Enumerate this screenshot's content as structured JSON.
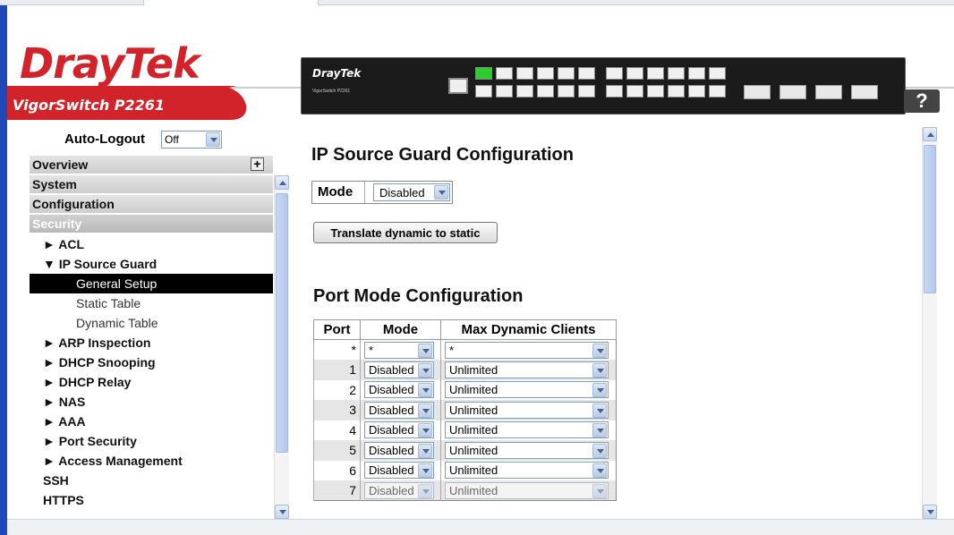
{
  "header": {
    "brand": "DrayTek",
    "model": "VigorSwitch P2261",
    "device_brand": "DrayTek",
    "device_model": "VigorSwitch P2261",
    "help_label": "?"
  },
  "auto_logout": {
    "label": "Auto-Logout",
    "value": "Off"
  },
  "sidebar": {
    "headers": [
      {
        "label": "Overview"
      },
      {
        "label": "System"
      },
      {
        "label": "Configuration"
      },
      {
        "label": "Security"
      }
    ],
    "items": [
      {
        "label": "► ACL",
        "type": "item"
      },
      {
        "label": "▼ IP Source Guard",
        "type": "item"
      },
      {
        "label": "General Setup",
        "type": "sub-selected"
      },
      {
        "label": "Static Table",
        "type": "sub"
      },
      {
        "label": "Dynamic Table",
        "type": "sub"
      },
      {
        "label": "► ARP Inspection",
        "type": "item"
      },
      {
        "label": "► DHCP Snooping",
        "type": "item"
      },
      {
        "label": "► DHCP Relay",
        "type": "item"
      },
      {
        "label": "► NAS",
        "type": "item"
      },
      {
        "label": "► AAA",
        "type": "item"
      },
      {
        "label": "► Port Security",
        "type": "item"
      },
      {
        "label": "► Access Management",
        "type": "item"
      },
      {
        "label": "SSH",
        "type": "item"
      },
      {
        "label": "HTTPS",
        "type": "item"
      }
    ]
  },
  "main": {
    "title": "IP Source Guard Configuration",
    "mode_label": "Mode",
    "mode_value": "Disabled",
    "translate_button": "Translate dynamic to static",
    "port_title": "Port Mode Configuration",
    "table": {
      "headers": [
        "Port",
        "Mode",
        "Max Dynamic Clients"
      ],
      "rows": [
        {
          "port": "*",
          "mode": "*",
          "max": "*"
        },
        {
          "port": "1",
          "mode": "Disabled",
          "max": "Unlimited"
        },
        {
          "port": "2",
          "mode": "Disabled",
          "max": "Unlimited"
        },
        {
          "port": "3",
          "mode": "Disabled",
          "max": "Unlimited"
        },
        {
          "port": "4",
          "mode": "Disabled",
          "max": "Unlimited"
        },
        {
          "port": "5",
          "mode": "Disabled",
          "max": "Unlimited"
        },
        {
          "port": "6",
          "mode": "Disabled",
          "max": "Unlimited"
        },
        {
          "port": "7",
          "mode": "Disabled",
          "max": "Unlimited"
        }
      ]
    }
  },
  "colors": {
    "brand_red": "#d2232a",
    "accent_blue": "#1f48b8",
    "selected_bg": "#000000"
  }
}
